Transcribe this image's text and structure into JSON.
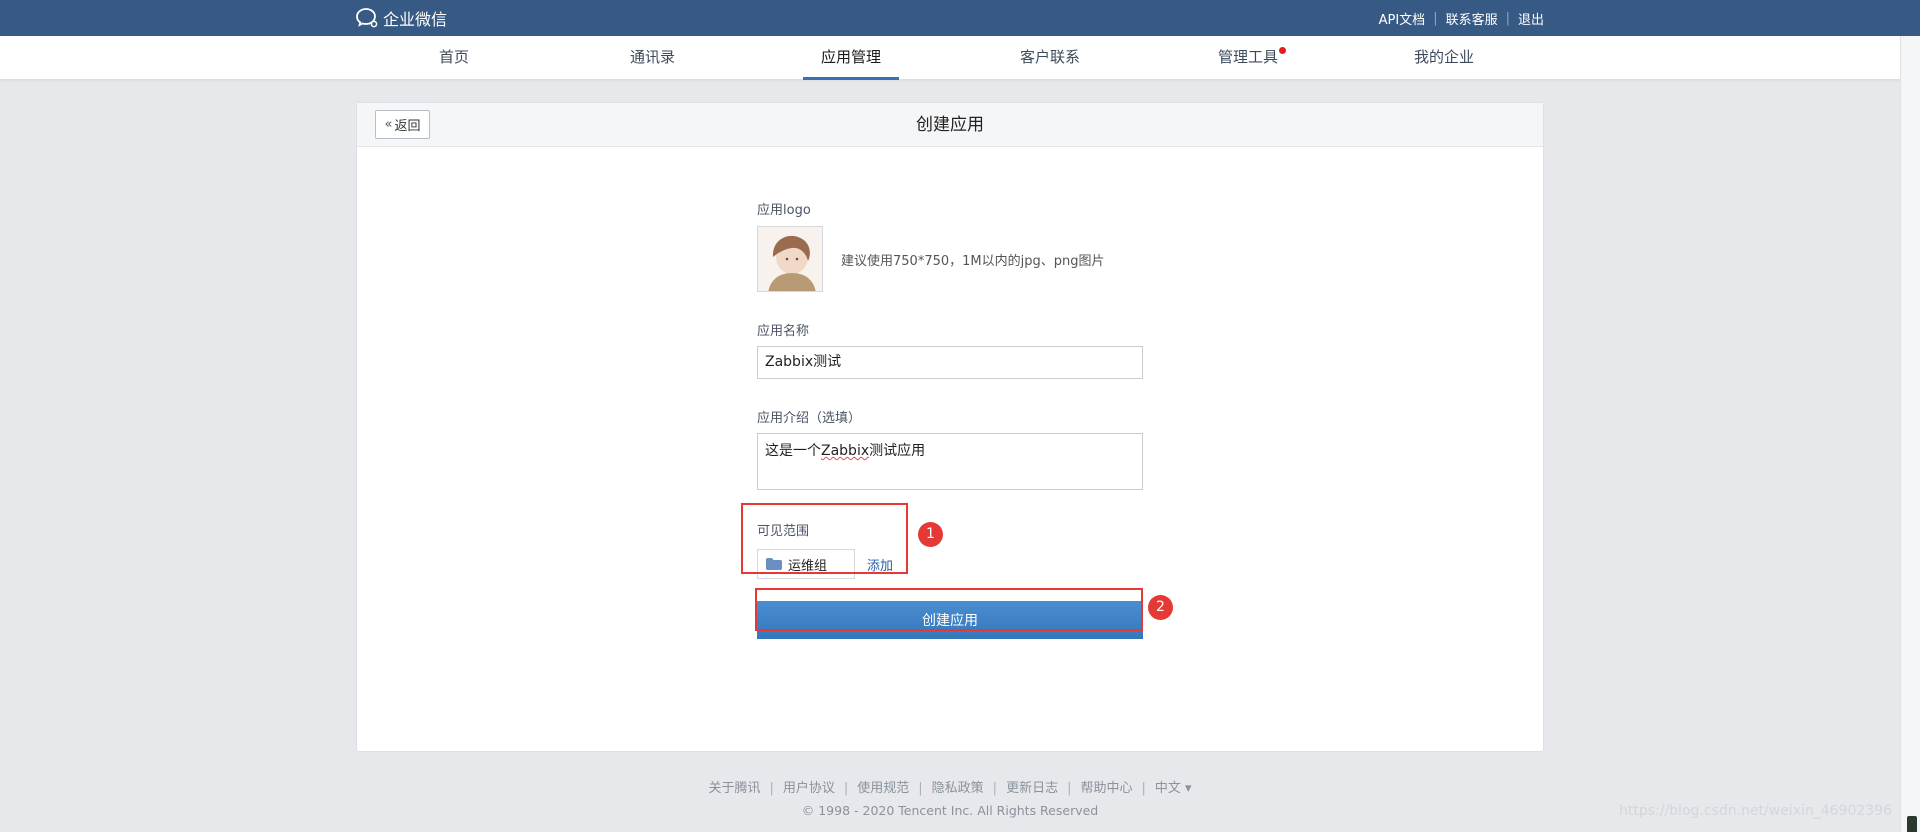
{
  "topbar": {
    "brand": "企业微信",
    "links": [
      "API文档",
      "联系客服",
      "退出"
    ],
    "colors": {
      "bg": "#375a85"
    }
  },
  "nav": {
    "items": [
      "首页",
      "通讯录",
      "应用管理",
      "客户联系",
      "管理工具",
      "我的企业"
    ],
    "active_index": 2
  },
  "panel": {
    "back_label": "返回",
    "title": "创建应用"
  },
  "form": {
    "logo_label": "应用logo",
    "logo_hint": "建议使用750*750，1M以内的jpg、png图片",
    "name_label": "应用名称",
    "name_value": "Zabbix测试",
    "intro_label": "应用介绍（选填）",
    "intro_prefix": "这是一个",
    "intro_underlined": "Zabbix",
    "intro_suffix": "测试应用",
    "scope_label": "可见范围",
    "scope_chip": "运维组",
    "scope_add": "添加",
    "submit_label": "创建应用"
  },
  "annotations": {
    "badge_1": "1",
    "badge_2": "2"
  },
  "footer": {
    "links": [
      "关于腾讯",
      "用户协议",
      "使用规范",
      "隐私政策",
      "更新日志",
      "帮助中心",
      "中文 ▾"
    ],
    "copyright": "© 1998 - 2020 Tencent Inc. All Rights Reserved"
  },
  "watermark": "https://blog.csdn.net/weixin_46902396"
}
